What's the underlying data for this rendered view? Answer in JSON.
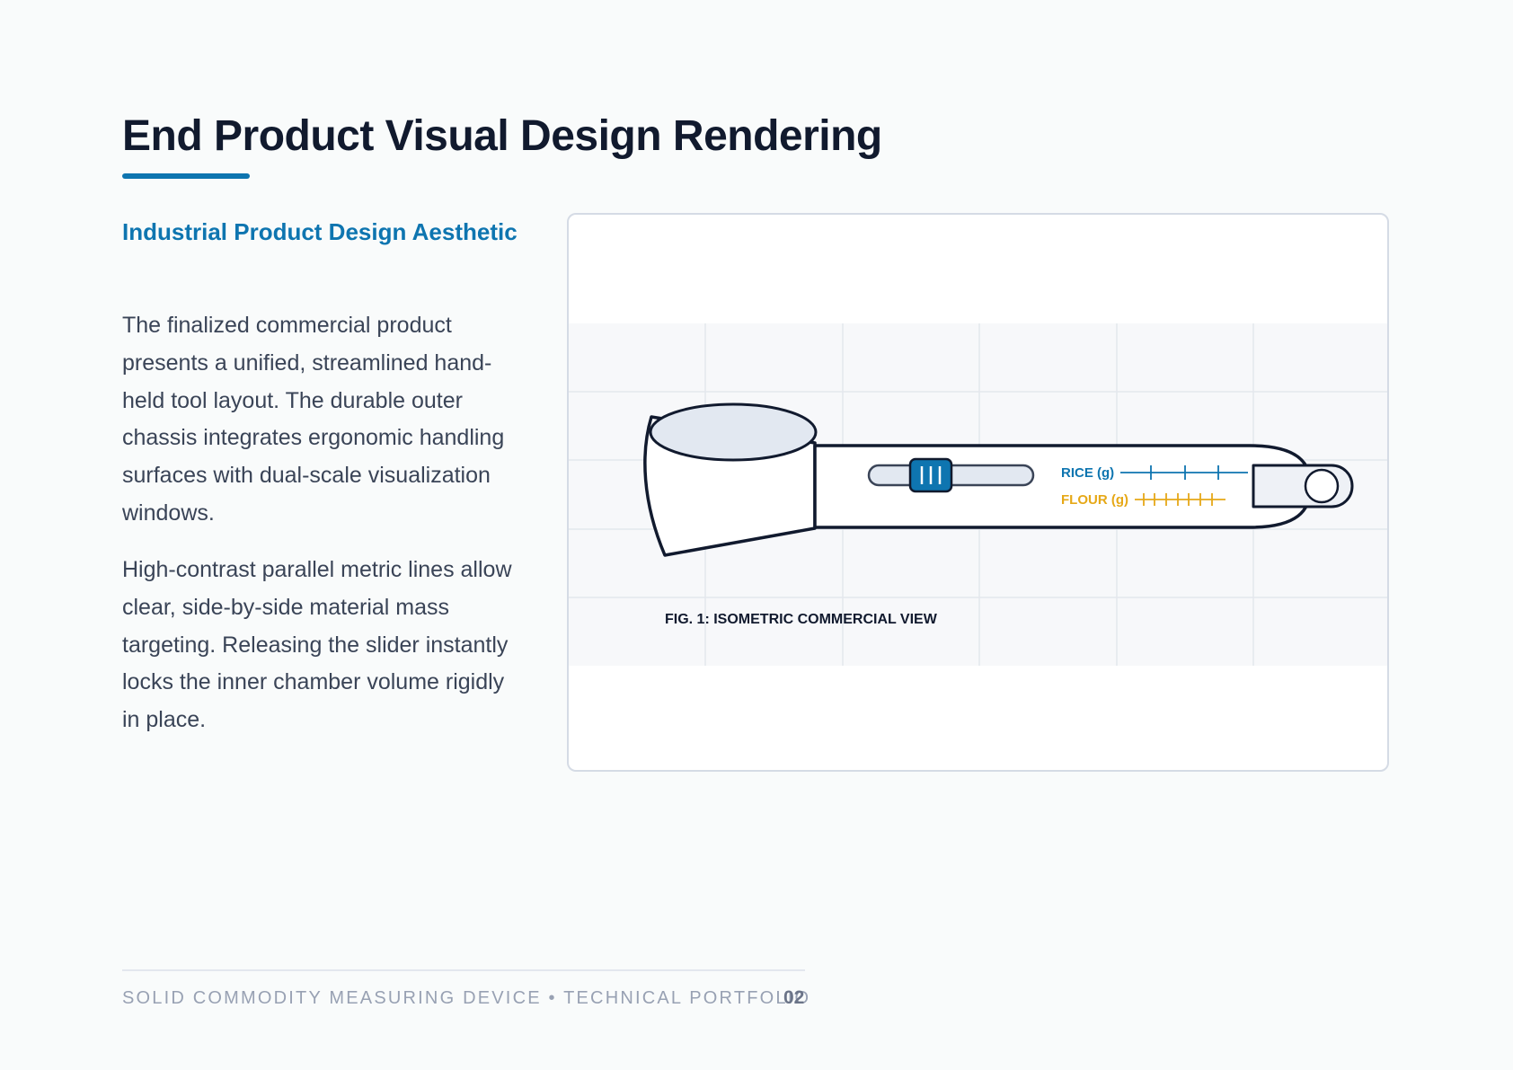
{
  "page": {
    "title": "End Product Visual Design Rendering",
    "accent_color": "#0e75b0"
  },
  "left_column": {
    "heading": "Industrial Product Design Aesthetic",
    "paragraph_1": "The finalized commercial product presents a unified, streamlined hand-held tool layout. The durable outer chassis integrates ergonomic handling surfaces with dual-scale visualization windows.",
    "paragraph_2": "High-contrast parallel metric lines allow clear, side-by-side material mass targeting. Releasing the slider instantly locks the inner chamber volume rigidly in place."
  },
  "figure": {
    "caption": "FIG. 1: ISOMETRIC COMMERCIAL VIEW",
    "scales": [
      {
        "label": "RICE (g)",
        "color": "#0e75b0"
      },
      {
        "label": "FLOUR (g)",
        "color": "#e6a817"
      }
    ],
    "slider_color": "#0e75b0"
  },
  "footer": {
    "text": "SOLID COMMODITY MEASURING DEVICE • TECHNICAL PORTFOLIO",
    "page_number": "02"
  }
}
